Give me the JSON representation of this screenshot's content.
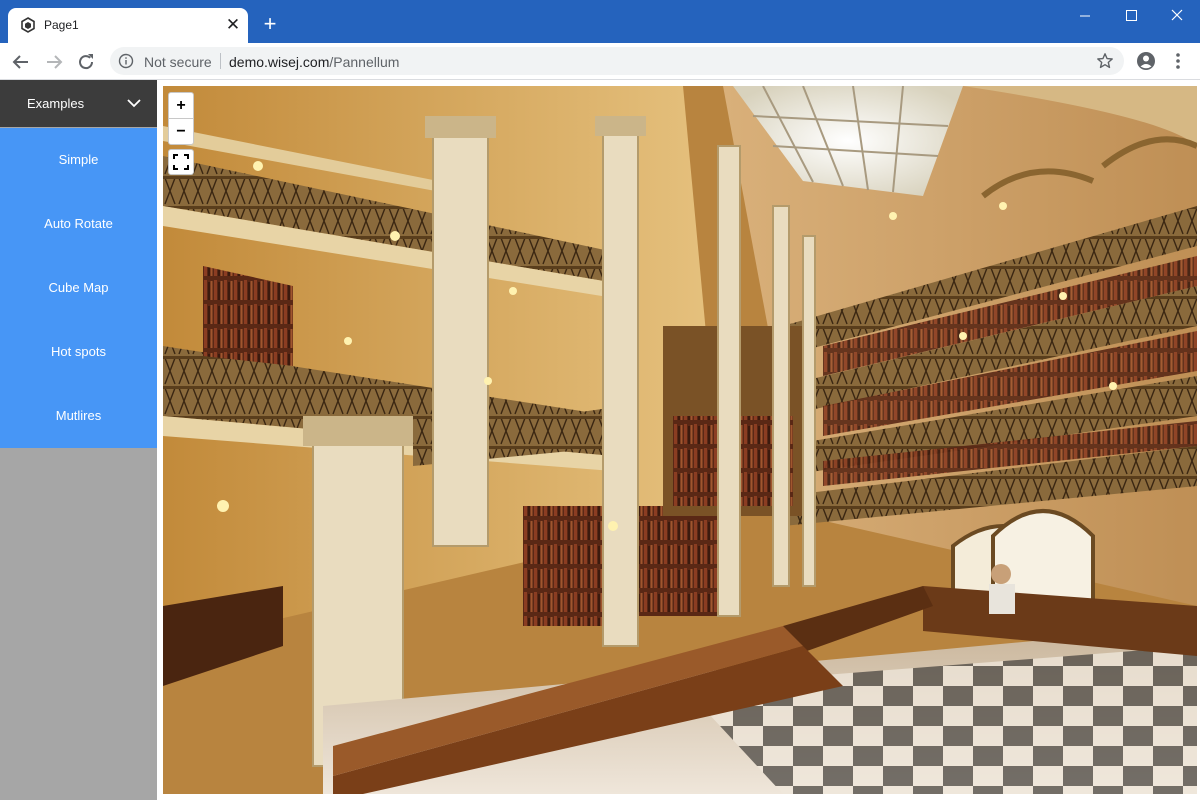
{
  "browser": {
    "tab_title": "Page1",
    "tab_close_glyph": "✕",
    "new_tab_glyph": "+",
    "security_label": "Not secure",
    "url_host": "demo.wisej.com",
    "url_path": "/Pannellum",
    "titlebar_color": "#2563bd",
    "icons": [
      "back-icon",
      "forward-icon",
      "reload-icon",
      "info-icon",
      "star-icon",
      "account-icon",
      "menu-icon",
      "minimize-icon",
      "maximize-icon",
      "close-icon"
    ]
  },
  "sidebar": {
    "header_label": "Examples",
    "accent_color": "#4796f6",
    "items": [
      {
        "label": "Simple"
      },
      {
        "label": "Auto Rotate"
      },
      {
        "label": "Cube Map"
      },
      {
        "label": "Hot spots"
      },
      {
        "label": "Mutlires"
      }
    ]
  },
  "viewer": {
    "zoom_in_label": "+",
    "zoom_out_label": "−",
    "scene_icon": "library-panorama-image"
  }
}
